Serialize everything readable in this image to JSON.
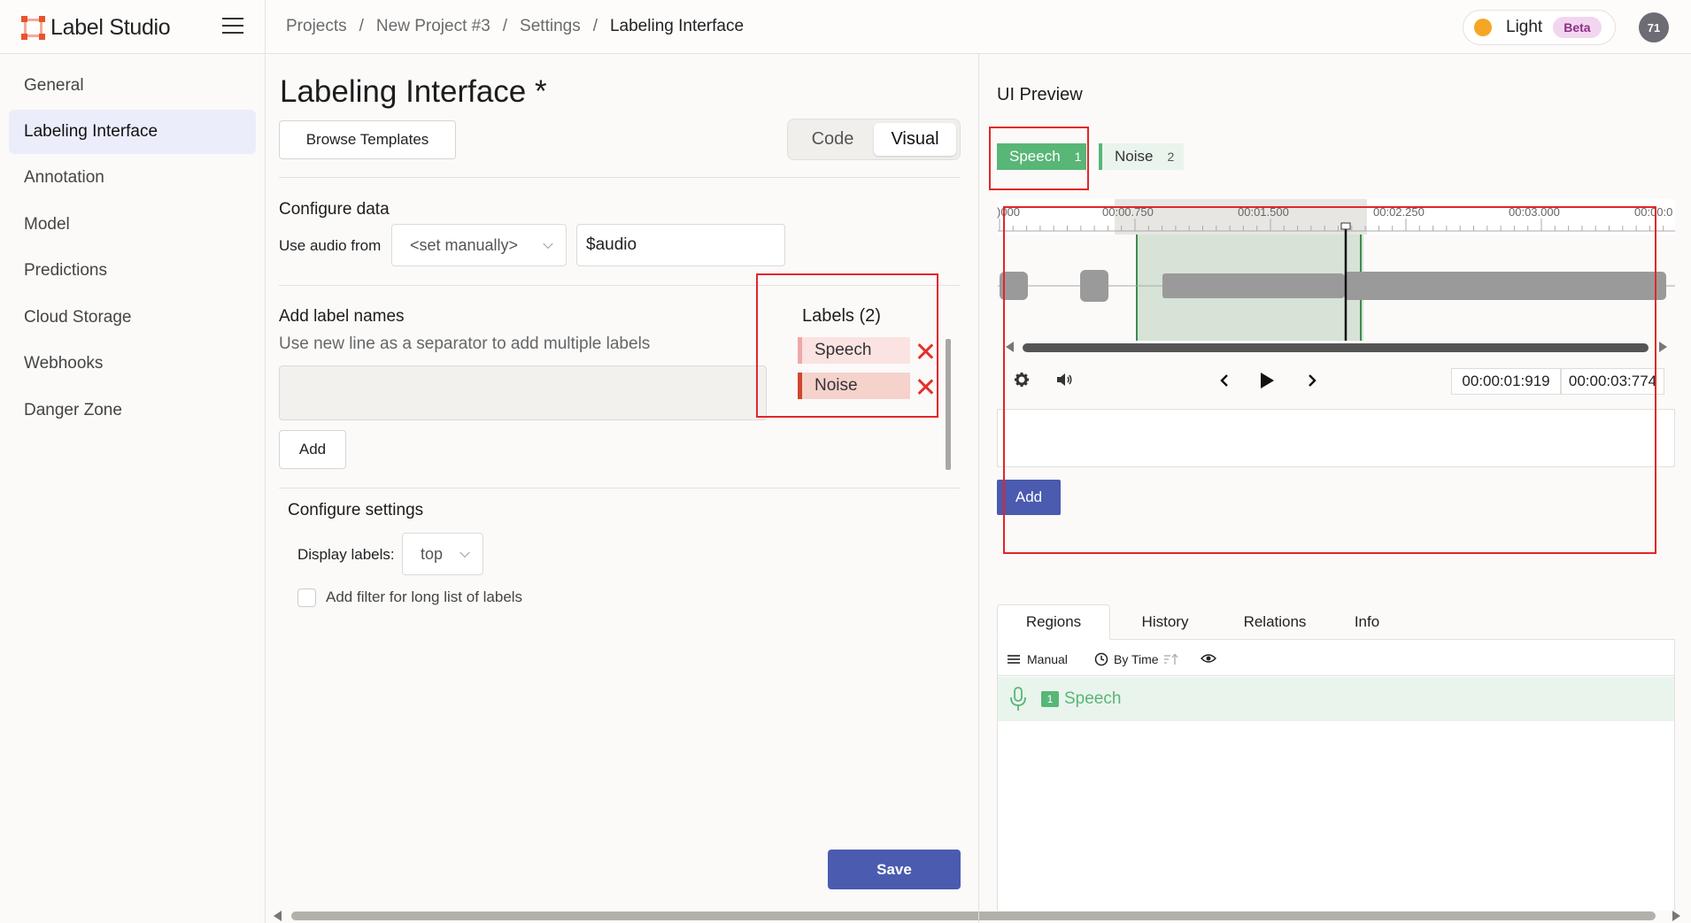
{
  "app": {
    "name": "Label Studio"
  },
  "breadcrumb": [
    "Projects",
    "New Project #3",
    "Settings",
    "Labeling Interface"
  ],
  "theme": {
    "label": "Light",
    "badge": "Beta"
  },
  "user": {
    "initials": "71"
  },
  "sidebar": {
    "items": [
      {
        "label": "General",
        "active": false
      },
      {
        "label": "Labeling Interface",
        "active": true
      },
      {
        "label": "Annotation",
        "active": false
      },
      {
        "label": "Model",
        "active": false
      },
      {
        "label": "Predictions",
        "active": false
      },
      {
        "label": "Cloud Storage",
        "active": false
      },
      {
        "label": "Webhooks",
        "active": false
      },
      {
        "label": "Danger Zone",
        "active": false
      }
    ]
  },
  "main": {
    "title": "Labeling Interface *",
    "browse_templates": "Browse Templates",
    "view_toggle": {
      "code": "Code",
      "visual": "Visual",
      "selected": "Visual"
    },
    "configure_data": {
      "title": "Configure data",
      "use_audio_from": "Use audio from",
      "source_select": "<set manually>",
      "source_value": "$audio"
    },
    "add_label_names": {
      "title": "Add label names",
      "description": "Use new line as a separator to add multiple labels",
      "textarea_value": "",
      "add_button": "Add"
    },
    "labels": {
      "title": "Labels (2)",
      "items": [
        {
          "name": "Speech",
          "color": "#f0a8a6"
        },
        {
          "name": "Noise",
          "color": "#d0472d"
        }
      ]
    },
    "configure_settings": {
      "title": "Configure settings",
      "display_labels_label": "Display labels:",
      "display_labels_value": "top",
      "filter_checkbox_label": "Add filter for long list of labels",
      "filter_checked": false
    },
    "save_button": "Save"
  },
  "preview": {
    "title": "UI Preview",
    "labels": [
      {
        "name": "Speech",
        "hotkey": "1",
        "selected": true,
        "color": "#58b677"
      },
      {
        "name": "Noise",
        "hotkey": "2",
        "selected": false,
        "color": "#58b677"
      }
    ],
    "timeline_ticks": [
      ")000",
      "00:00.750",
      "00:01.500",
      "00:02.250",
      "00:03.000",
      "00:00:0"
    ],
    "current_time": "00:00:01:919",
    "duration": "00:00:03:774",
    "add_button": "Add",
    "tabs": [
      "Regions",
      "History",
      "Relations",
      "Info"
    ],
    "active_tab": "Regions",
    "region_toolbar": {
      "group": "Manual",
      "sort": "By Time"
    },
    "regions": [
      {
        "index": "1",
        "label": "Speech"
      }
    ]
  },
  "colors": {
    "accent": "#4a5bb0",
    "speech": "#58b677",
    "highlight_box": "#e2262a"
  }
}
